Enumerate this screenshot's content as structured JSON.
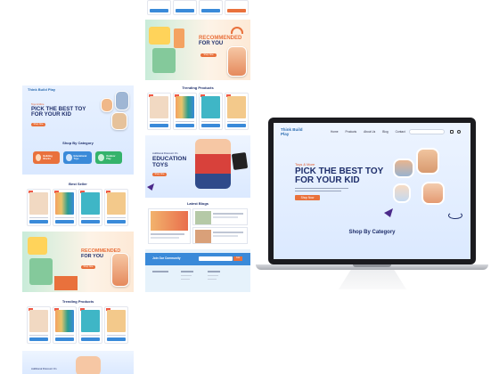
{
  "brand": {
    "name": "Think Build Play"
  },
  "nav": {
    "links": [
      "Home",
      "Products",
      "About Us",
      "Blog",
      "Contact"
    ],
    "search_placeholder": "Search"
  },
  "hero": {
    "kicker": "Toys & More",
    "title_line1": "PICK THE BEST TOY",
    "title_line2": "FOR YOUR KID",
    "cta": "Shop Now",
    "category_heading": "Shop By Category"
  },
  "categories": [
    {
      "label": "Building Blocks",
      "color": "#e9713c"
    },
    {
      "label": "Educational Toys",
      "color": "#3a8ad9"
    },
    {
      "label": "Outdoor Play",
      "color": "#34b36b"
    }
  ],
  "sections": {
    "best_seller": "Best Seller",
    "trending": "Trending Products",
    "latest_blogs": "Latest Blogs",
    "recommended_line1": "RECOMMENDED",
    "recommended_line2": "FOR YOU",
    "edu_kicker": "Additional Discount On",
    "edu_line1": "EDUCATION",
    "edu_line2": "TOYS",
    "join_community": "Join Our Community",
    "join_button": "Join"
  },
  "colors": {
    "brand_blue": "#1f2f6b",
    "accent_orange": "#e9713c",
    "link_blue": "#3a8ad9"
  }
}
